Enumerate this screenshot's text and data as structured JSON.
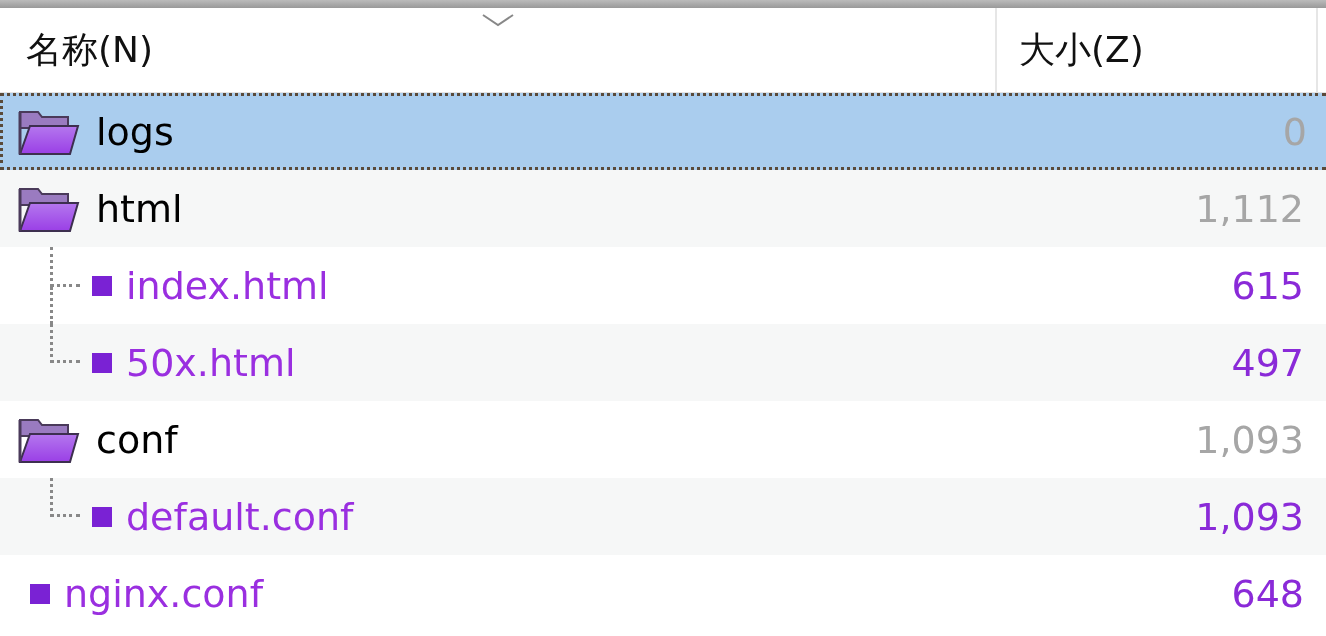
{
  "columns": [
    {
      "label": "名称(N)",
      "sorted": true
    },
    {
      "label": "大小(Z)",
      "sorted": false
    }
  ],
  "rows": [
    {
      "kind": "folder",
      "name": "logs",
      "size": "0",
      "selected": true
    },
    {
      "kind": "folder",
      "name": "html",
      "size": "1,112",
      "selected": false,
      "children": [
        {
          "kind": "file",
          "name": "index.html",
          "size": "615",
          "selected": false
        },
        {
          "kind": "file",
          "name": "50x.html",
          "size": "497",
          "selected": false
        }
      ]
    },
    {
      "kind": "folder",
      "name": "conf",
      "size": "1,093",
      "selected": false,
      "children": [
        {
          "kind": "file",
          "name": "default.conf",
          "size": "1,093",
          "selected": false
        }
      ]
    },
    {
      "kind": "file",
      "name": "nginx.conf",
      "size": "648",
      "selected": false
    }
  ]
}
